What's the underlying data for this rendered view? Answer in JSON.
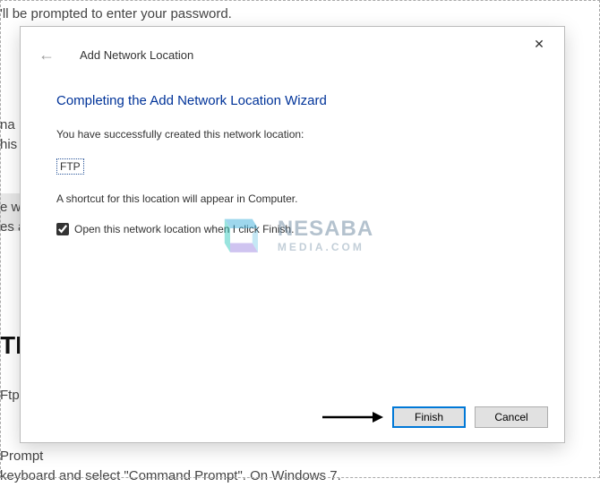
{
  "background": {
    "line1": "'ll be prompted to enter your password.",
    "frag_na": "na",
    "frag_his": "his",
    "frag_ew": "e w",
    "frag_esa": "es a",
    "heading_tp": "TP",
    "frag_ftp": "Ftp",
    "frag_bottom1": "Prompt",
    "frag_bottom2": "keyboard and select \"Command Prompt\". On Windows 7."
  },
  "dialog": {
    "wizard_name": "Add Network Location",
    "close_glyph": "✕",
    "back_glyph": "←",
    "heading": "Completing the Add Network Location Wizard",
    "success_line": "You have successfully created this network location:",
    "location_name": "FTP",
    "shortcut_line": "A shortcut for this location will appear in Computer.",
    "checkbox_label": "Open this network location when I click Finish.",
    "checkbox_checked": true,
    "finish_label": "Finish",
    "cancel_label": "Cancel"
  },
  "watermark": {
    "top": "NESABA",
    "bottom": "MEDIA.COM"
  }
}
